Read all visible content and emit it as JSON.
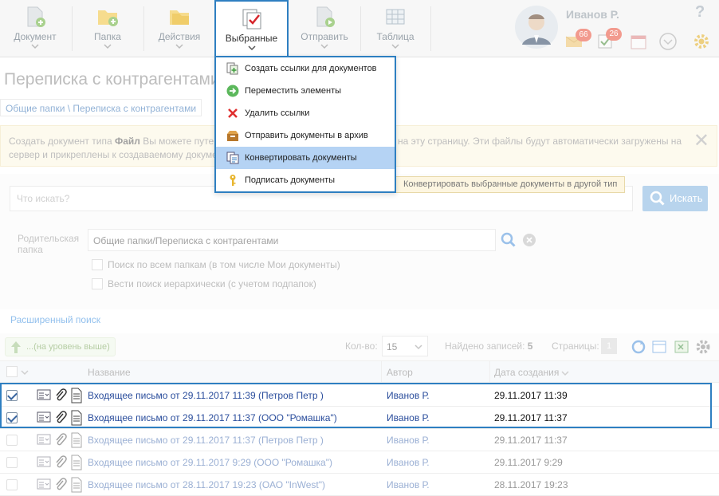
{
  "toolbar": {
    "document": "Документ",
    "folder": "Папка",
    "actions": "Действия",
    "favorites": "Выбранные",
    "send": "Отправить",
    "table": "Таблица",
    "user_name": "Иванов Р.",
    "badge_mail": "66",
    "badge_tasks": "26",
    "help": "?"
  },
  "dropdown": {
    "items": [
      {
        "label": "Создать ссылки для документов",
        "icon": "create-links-icon"
      },
      {
        "label": "Переместить элементы",
        "icon": "move-arrow-icon"
      },
      {
        "label": "Удалить ссылки",
        "icon": "delete-x-icon"
      },
      {
        "label": "Отправить документы в архив",
        "icon": "archive-box-icon"
      },
      {
        "label": "Конвертировать документы",
        "icon": "convert-documents-icon",
        "highlighted": true
      },
      {
        "label": "Подписать документы",
        "icon": "key-sign-icon"
      }
    ],
    "tooltip": "Конвертировать выбранные документы в другой тип"
  },
  "page": {
    "title": "Переписка с контрагентами",
    "breadcrumb": "Общие папки \\ Переписка с контрагентами",
    "notice_prefix": "Создать документ типа ",
    "notice_bold": "Файл",
    "notice_line1_rest": " Вы можете путе",
    "notice_line1_tail": "на эту страницу. Эти файлы будут автоматически загружены на",
    "notice_line2": "сервер и прикреплены к создаваемому докуме",
    "close": "✕"
  },
  "search": {
    "placeholder": "Что искать?",
    "button": "Искать",
    "parent_label": "Родительская папка",
    "parent_value": "Общие папки/Переписка с контрагентами",
    "opt_all_folders": "Поиск по всем папкам (в том числе Мои документы)",
    "opt_hierarchical": "Вести поиск иерархически (с учетом подпапок)",
    "advanced": "Расширенный поиск"
  },
  "list": {
    "up_level": "...(на уровень выше)",
    "count_label": "Кол-во:",
    "count_value": "15",
    "found_label": "Найдено записей:",
    "found_value": "5",
    "pages_label": "Страницы:",
    "pages_value": "1",
    "col_name": "Название",
    "col_author": "Автор",
    "col_date": "Дата создания",
    "rows": [
      {
        "name": "Входящее письмо от 29.11.2017 11:39 (Петров Петр )",
        "author": "Иванов Р.",
        "date": "29.11.2017 11:39",
        "checked": true
      },
      {
        "name": "Входящее письмо от 29.11.2017 11:37 (ООО \"Ромашка\")",
        "author": "Иванов Р.",
        "date": "29.11.2017 11:37",
        "checked": true
      },
      {
        "name": "Входящее письмо от 29.11.2017 11:37 (Петров Петр )",
        "author": "Иванов Р.",
        "date": "29.11.2017 11:37",
        "checked": false
      },
      {
        "name": "Входящее письмо от 29.11.2017 9:29 (ООО \"Ромашка\")",
        "author": "Иванов Р.",
        "date": "29.11.2017 9:29",
        "checked": false
      },
      {
        "name": "Входящее письмо от 28.11.2017 19:23 (ОАО \"InWest\")",
        "author": "Иванов Р.",
        "date": "28.11.2017 19:23",
        "checked": false
      }
    ]
  }
}
